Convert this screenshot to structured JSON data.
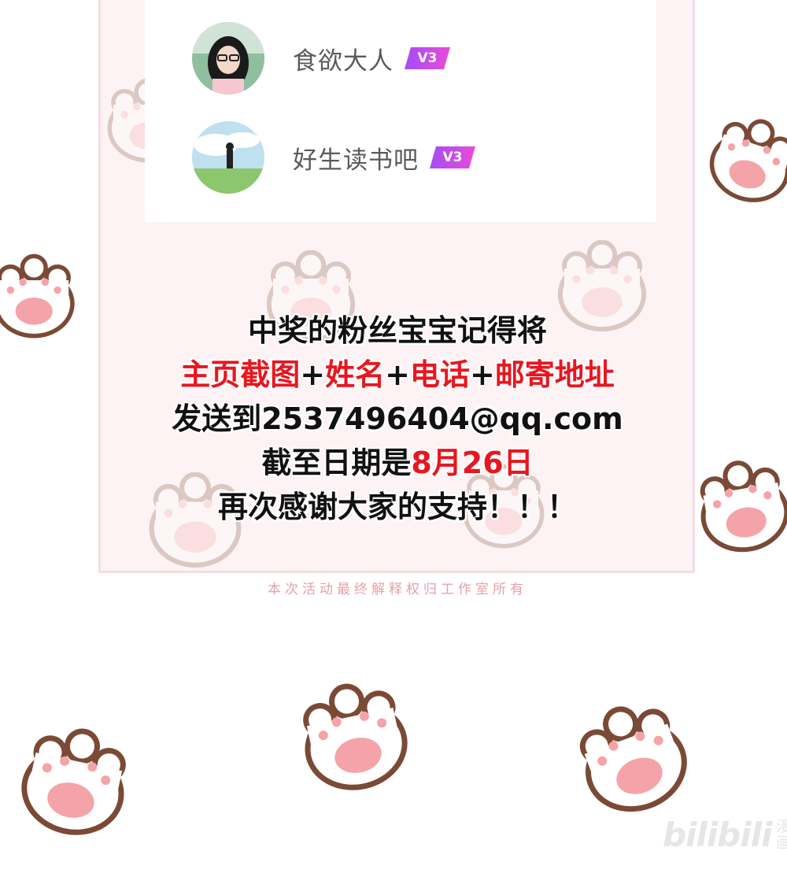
{
  "winners": [
    {
      "name": "食欲大人",
      "badge": "V3",
      "avatar": "avatar-photo-girl-glasses"
    },
    {
      "name": "好生读书吧",
      "badge": "V3",
      "avatar": "avatar-photo-landscape"
    }
  ],
  "notice": {
    "line1": "中奖的粉丝宝宝记得将",
    "line2_part1": "主页截图",
    "line2_plus1": "+",
    "line2_part2": "姓名",
    "line2_plus2": "+",
    "line2_part3": "电话",
    "line2_plus3": "+",
    "line2_part4": "邮寄地址",
    "line3": "发送到2537496404@qq.com",
    "line4_prefix": "截至日期是",
    "line4_date": "8月26日",
    "line5": "再次感谢大家的支持！！！"
  },
  "footer_note": "本次活动最终解释权归工作室所有",
  "watermark": {
    "brand": "bilibili",
    "tag": "漫画"
  },
  "colors": {
    "accent_red": "#e8161f",
    "badge_purple": "#c33ef0",
    "paw_brown": "#7a4a35",
    "paw_pink": "#f4a3a8"
  }
}
